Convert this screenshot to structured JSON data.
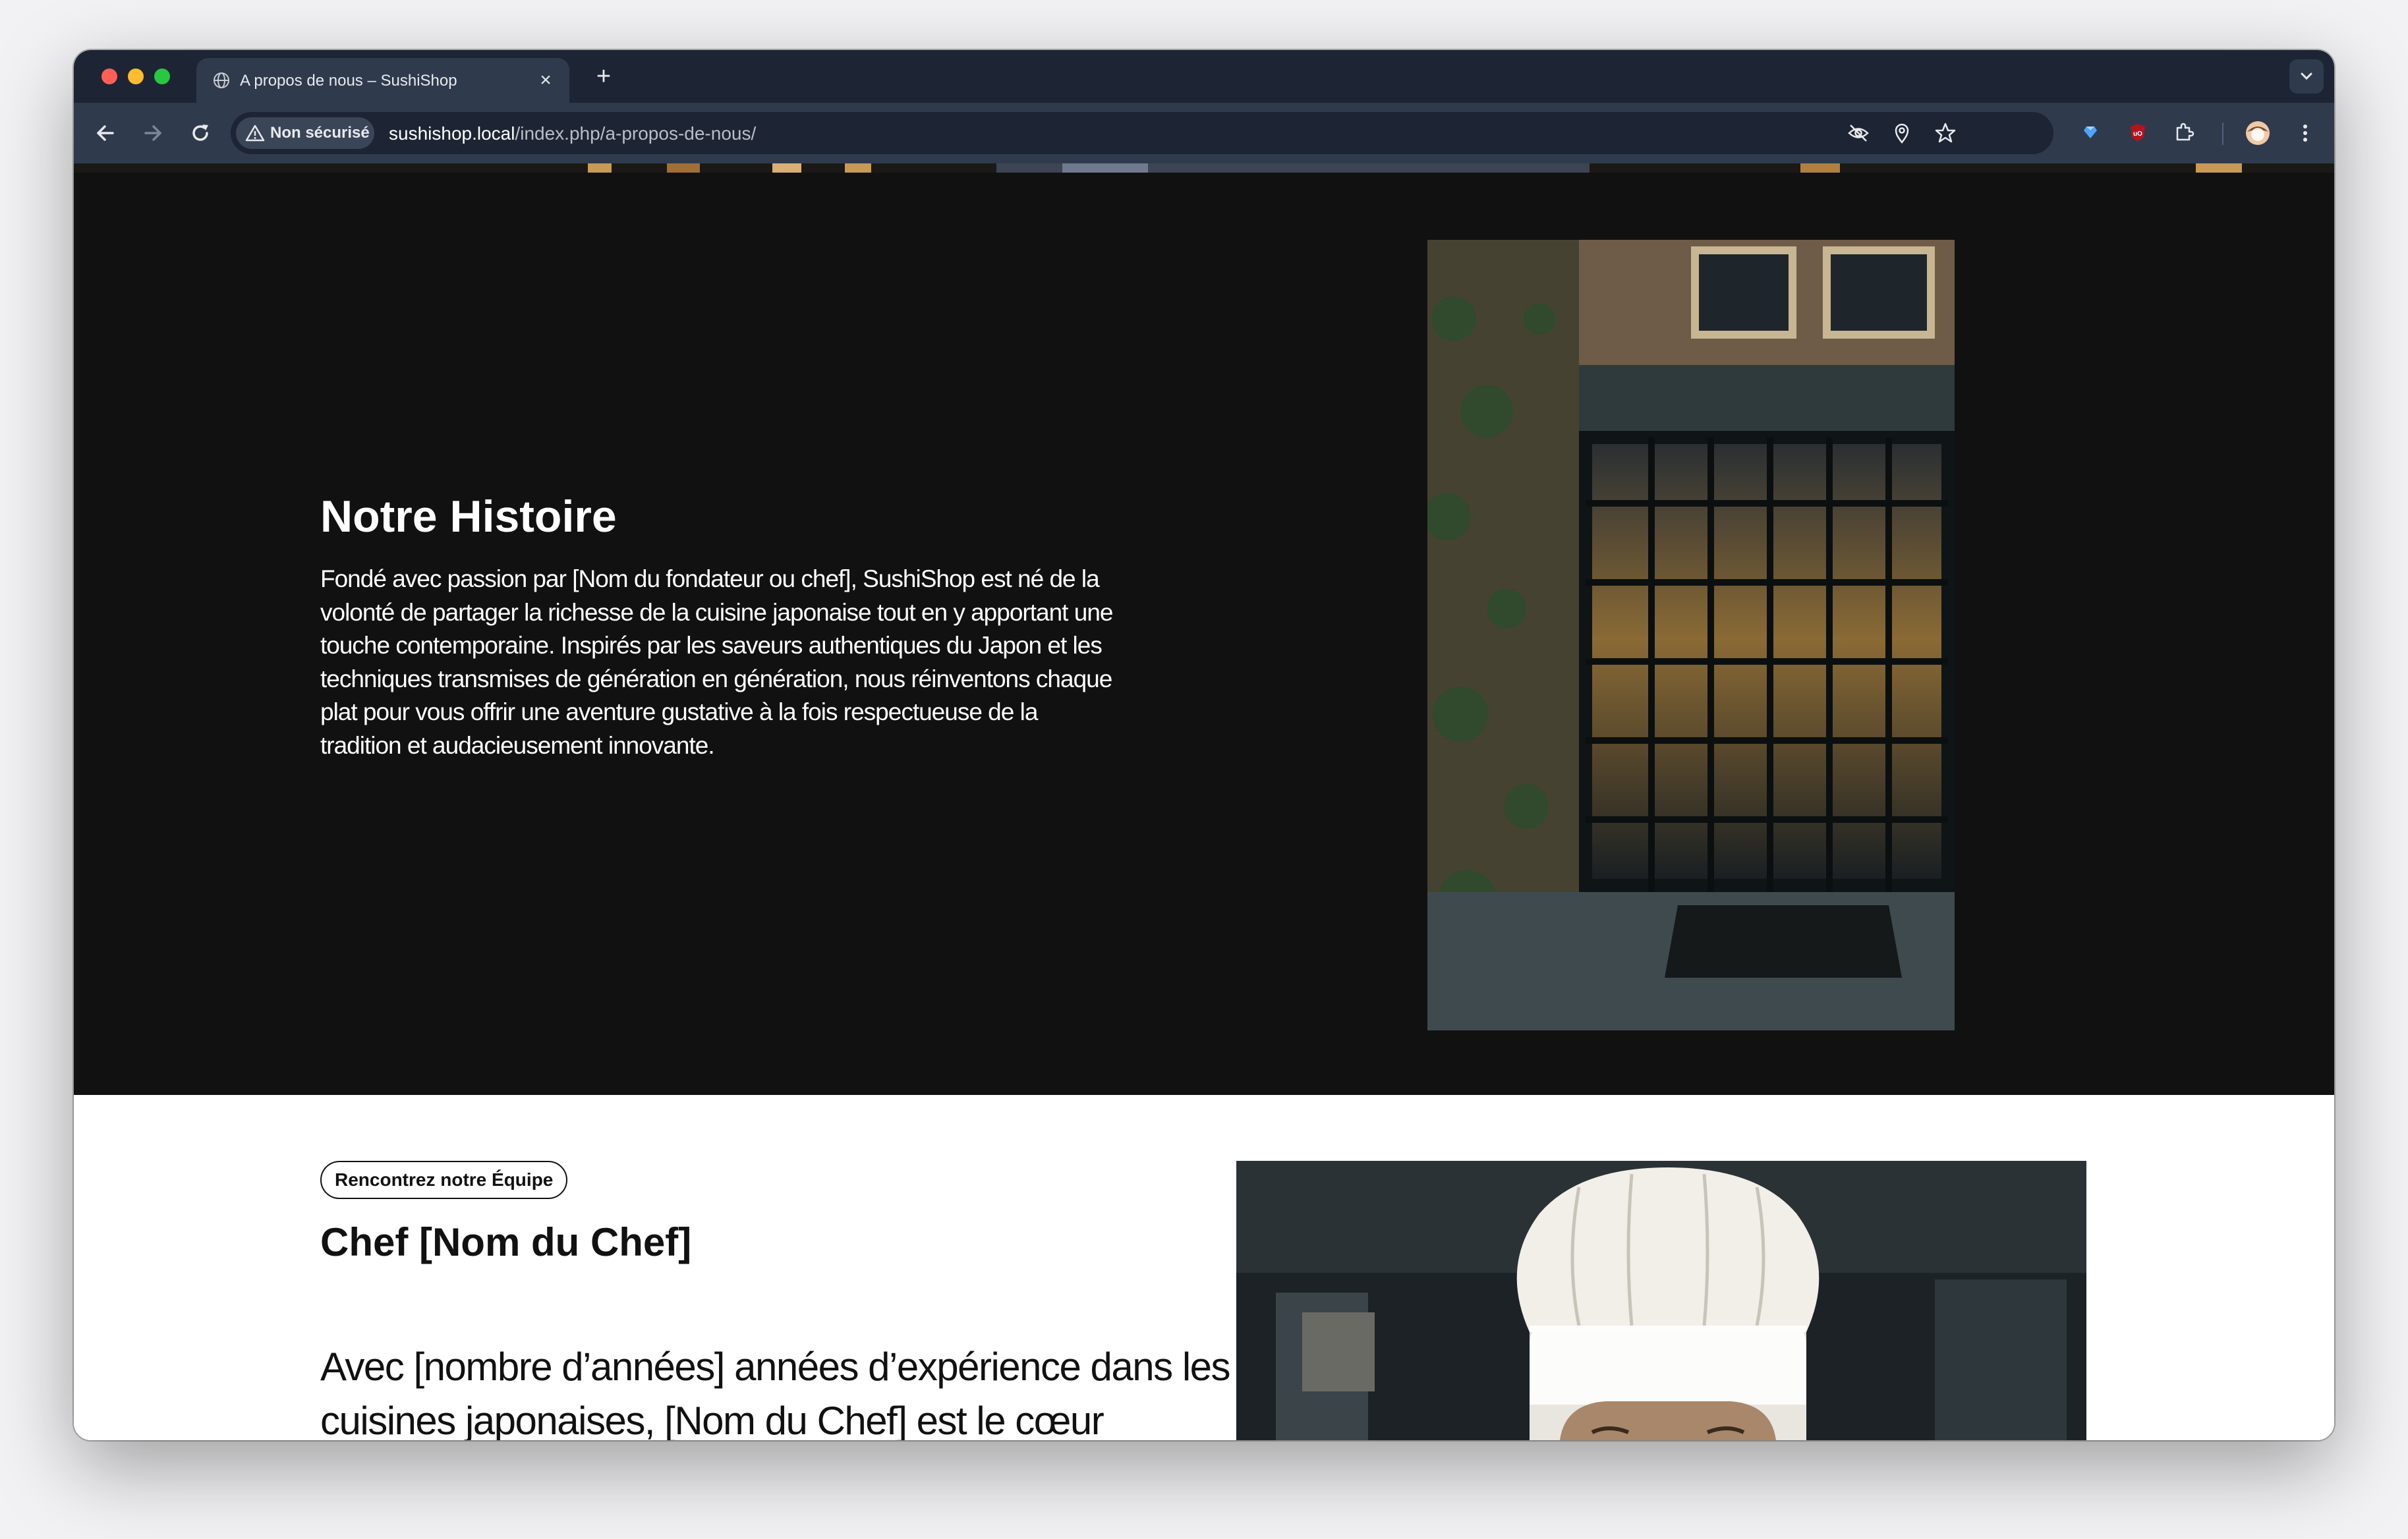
{
  "browser": {
    "tab_title": "A propos de nous – SushiShop",
    "tab_close": "×",
    "new_tab": "+",
    "security_label": "Non sécurisé",
    "url_host": "sushishop.local",
    "url_path": "/index.php/a-propos-de-nous/"
  },
  "history": {
    "title": "Notre Histoire",
    "body": "Fondé avec passion par [Nom du fondateur ou chef], SushiShop est né de la volonté de partager la richesse de la cuisine japonaise tout en y apportant une touche contemporaine. Inspirés par les saveurs authentiques du Japon et les techniques transmises de génération en génération, nous réinventons chaque plat pour vous offrir une aventure gustative à la fois respectueuse de la tradition et audacieusement innovante."
  },
  "team": {
    "badge": "Rencontrez notre Équipe",
    "chef_name": "Chef [Nom du Chef]",
    "chef_bio": "Avec [nombre d’années] années d’expérience dans les cuisines japonaises, [Nom du Chef] est le cœur"
  },
  "colors": {
    "tab_strip": "#1d2433",
    "toolbar": "#2f3a4d",
    "dark_section": "#111111",
    "white_section": "#ffffff"
  }
}
